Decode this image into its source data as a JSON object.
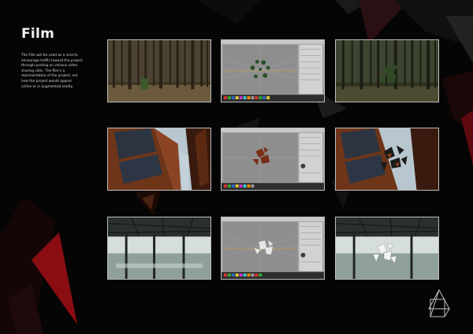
{
  "page": {
    "title": "Film",
    "description": "The Film will be used as a viral to encourage traffic toward the project through posting on various video sharing sites. The film's a representation of the project, not how the project would appear online or in augmented reality."
  },
  "frames": [
    {
      "row": "forest",
      "view": "live-footage"
    },
    {
      "row": "forest",
      "view": "3d-software"
    },
    {
      "row": "forest",
      "view": "composite"
    },
    {
      "row": "building",
      "view": "live-footage"
    },
    {
      "row": "building",
      "view": "3d-software"
    },
    {
      "row": "building",
      "view": "composite"
    },
    {
      "row": "warehouse",
      "view": "live-footage"
    },
    {
      "row": "warehouse",
      "view": "3d-software"
    },
    {
      "row": "warehouse",
      "view": "composite"
    }
  ],
  "colors": {
    "background": "#050505",
    "accent_red": "#8a0d12",
    "frame_border": "#bdbdbd"
  }
}
